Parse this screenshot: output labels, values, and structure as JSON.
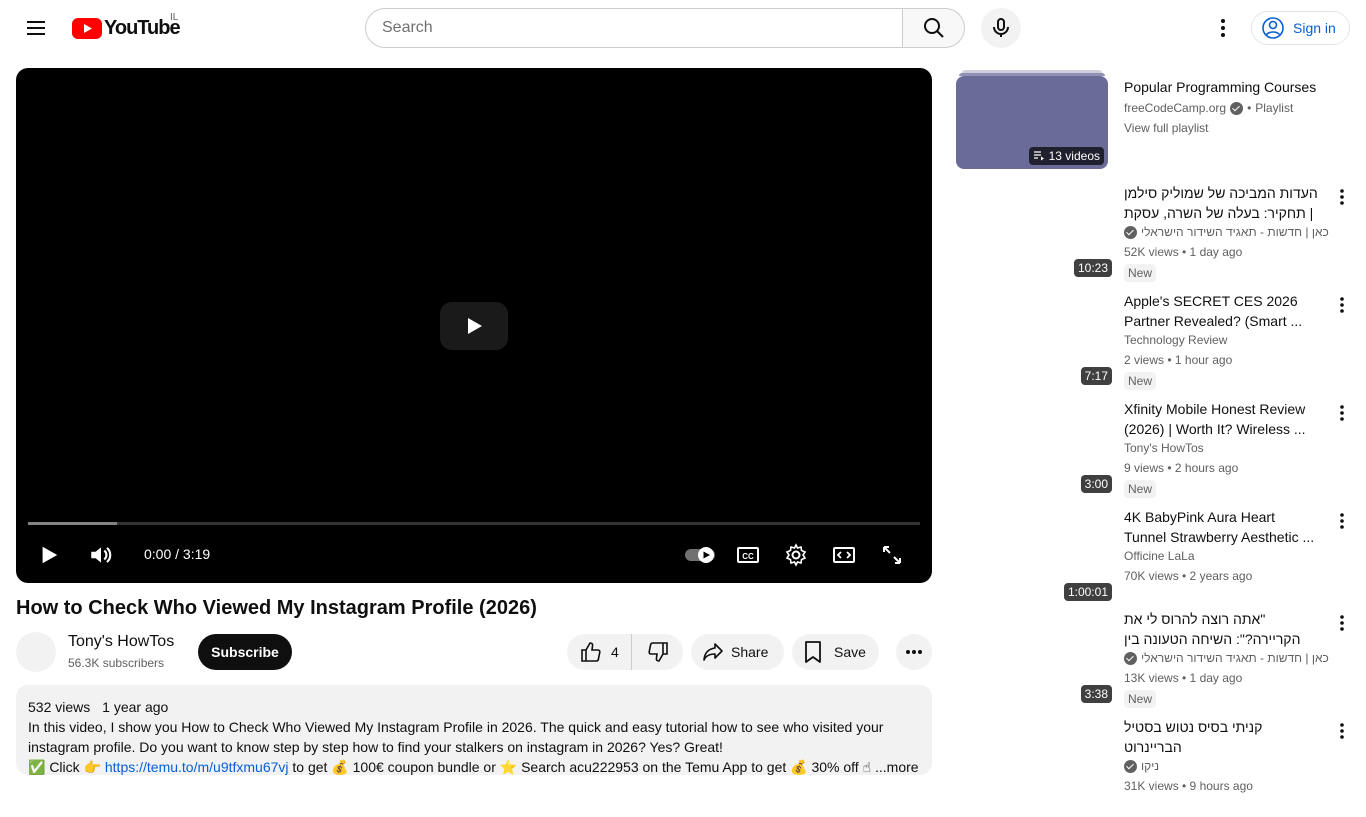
{
  "masthead": {
    "logo_text": "YouTube",
    "country_code": "IL",
    "search_placeholder": "Search",
    "signin_label": "Sign in"
  },
  "player": {
    "time": "0:00 / 3:19",
    "buffered_fraction": 0.1
  },
  "video": {
    "title": "How to Check Who Viewed My Instagram Profile (2026)",
    "channel": "Tony's HowTos",
    "subscribers": "56.3K subscribers",
    "subscribe_label": "Subscribe",
    "like_count": "4",
    "share_label": "Share",
    "save_label": "Save"
  },
  "description": {
    "views": "532 views",
    "date": "1 year ago",
    "text": "In this video, I show you How to Check Who Viewed My Instagram Profile in 2026. The quick and easy tutorial how to see who visited your instagram profile. Do you want to know step by step how to find your stalkers on instagram in 2026? Yes? Great!",
    "line3_prefix": "✅ Click 👉 ",
    "link": "https://temu.to/m/u9tfxmu67vj",
    "line3_suffix": " to get 💰 100€ coupon bundle or ⭐ Search  acu222953 on the Temu App to get 💰 30% off ☝",
    "more_label": "...more"
  },
  "playlist": {
    "title": "Popular Programming Courses",
    "channel": "freeCodeCamp.org",
    "type": "Playlist",
    "view_full": "View full playlist",
    "count": "13 videos"
  },
  "recommendations": [
    {
      "title": "העדות המביכה של שמוליק סילמן | תחקיר: בעלה של השרה, עסקת ...",
      "channel": "כאן | חדשות - תאגיד השידור הישראלי",
      "meta": "52K views • 1 day ago",
      "badge": "New",
      "duration": "10:23",
      "rtl": true
    },
    {
      "title": "Apple's SECRET CES 2026 Partner Revealed? (Smart ...",
      "channel": "Technology Review",
      "meta": "2 views • 1 hour ago",
      "badge": "New",
      "duration": "7:17",
      "rtl": false
    },
    {
      "title": "Xfinity Mobile Honest Review (2026) | Worth It? Wireless ...",
      "channel": "Tony's HowTos",
      "meta": "9 views • 2 hours ago",
      "badge": "New",
      "duration": "3:00",
      "rtl": false
    },
    {
      "title": "4K BabyPink Aura Heart Tunnel Strawberry Aesthetic ...",
      "channel": "Officine LaLa",
      "meta": "70K views • 2 years ago",
      "badge": "",
      "duration": "1:00:01",
      "rtl": false
    },
    {
      "title": "\"אתה רוצה להרוס לי את הקריירה?\": השיחה הטעונה בין רום ברסלבסקי ...",
      "channel": "כאן | חדשות - תאגיד השידור הישראלי",
      "meta": "13K views • 1 day ago",
      "badge": "New",
      "duration": "3:38",
      "rtl": true
    },
    {
      "title": "קניתי בסיס נטוש בסטיל הבריינרוט",
      "channel": "ניקו",
      "meta": "31K views • 9 hours ago",
      "badge": "",
      "duration": "",
      "rtl": true
    }
  ]
}
